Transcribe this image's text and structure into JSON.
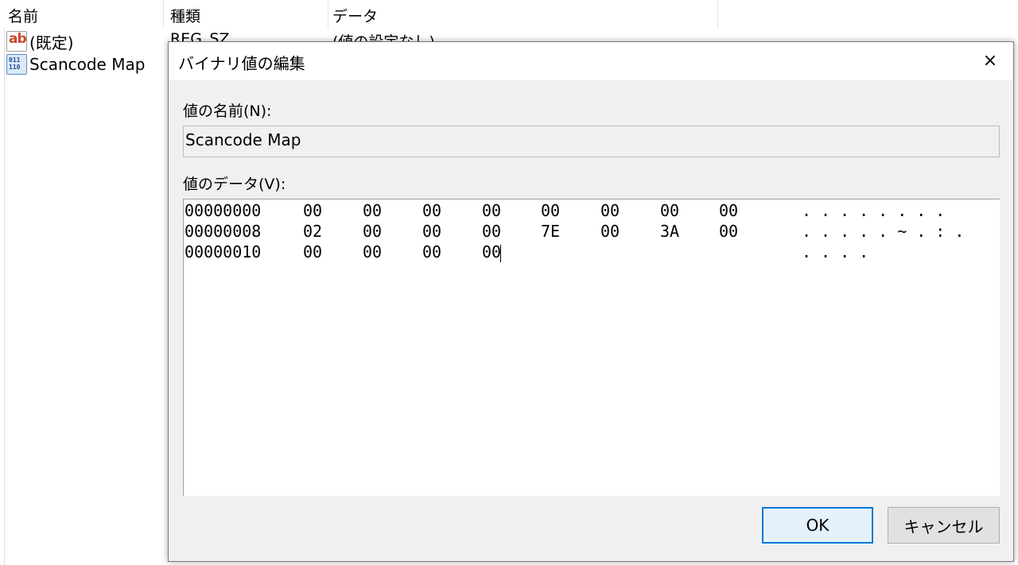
{
  "list": {
    "columns": {
      "name": "名前",
      "type": "種類",
      "data": "データ"
    },
    "rows": [
      {
        "icon": "string-value-icon",
        "icon_text": "ab",
        "name": "(既定)",
        "type": "REG_SZ",
        "data": "(値の設定なし)"
      },
      {
        "icon": "binary-value-icon",
        "icon_text_1": "011",
        "icon_text_2": "110",
        "name": "Scancode Map",
        "type": "",
        "data": ""
      }
    ]
  },
  "dialog": {
    "title": "バイナリ値の編集",
    "close": "×",
    "name_label": "値の名前(N):",
    "name_value": "Scancode Map",
    "data_label": "値のデータ(V):",
    "hex_rows": [
      {
        "addr": "00000000",
        "bytes": [
          "00",
          "00",
          "00",
          "00",
          "00",
          "00",
          "00",
          "00"
        ],
        "ascii": "........"
      },
      {
        "addr": "00000008",
        "bytes": [
          "02",
          "00",
          "00",
          "00",
          "7E",
          "00",
          "3A",
          "00"
        ],
        "ascii": ".....~.:."
      },
      {
        "addr": "00000010",
        "bytes": [
          "00",
          "00",
          "00",
          "00"
        ],
        "ascii": "...."
      }
    ],
    "ok_label": "OK",
    "cancel_label": "キャンセル"
  }
}
